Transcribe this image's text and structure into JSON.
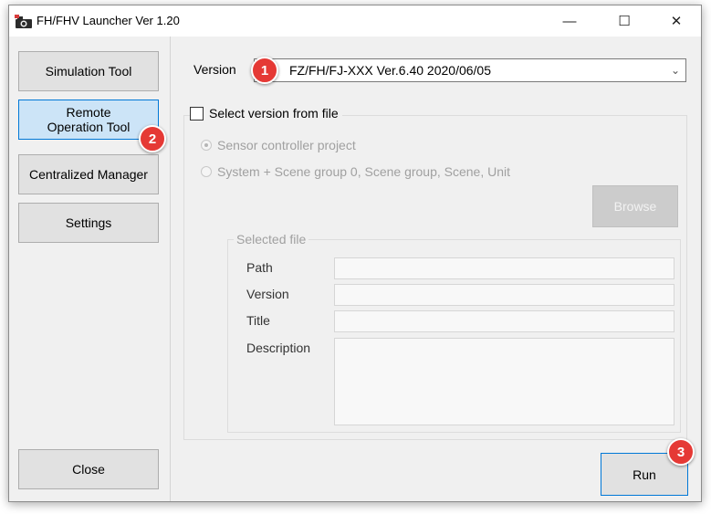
{
  "window": {
    "title": "FH/FHV Launcher Ver 1.20",
    "controls": {
      "minimize": "—",
      "maximize": "☐",
      "close": "✕"
    }
  },
  "sidebar": {
    "simulation": "Simulation Tool",
    "remote": "Remote Operation Tool",
    "centralized": "Centralized Manager",
    "settings": "Settings",
    "close": "Close"
  },
  "version": {
    "label": "Version",
    "selected": "FZ/FH/FJ-XXX Ver.6.40 2020/06/05"
  },
  "from_file": {
    "checkbox_label": "Select version from file",
    "checked": false,
    "radio_sensor": "Sensor controller project",
    "radio_system": "System + Scene group 0, Scene group, Scene, Unit",
    "browse": "Browse"
  },
  "selected_file": {
    "title": "Selected file",
    "path_label": "Path",
    "version_label": "Version",
    "title_label": "Title",
    "description_label": "Description"
  },
  "run": "Run",
  "badges": {
    "b1": "1",
    "b2": "2",
    "b3": "3"
  },
  "colors": {
    "badge": "#e53935",
    "accent": "#0078d7",
    "active_button": "#cce4f7"
  }
}
